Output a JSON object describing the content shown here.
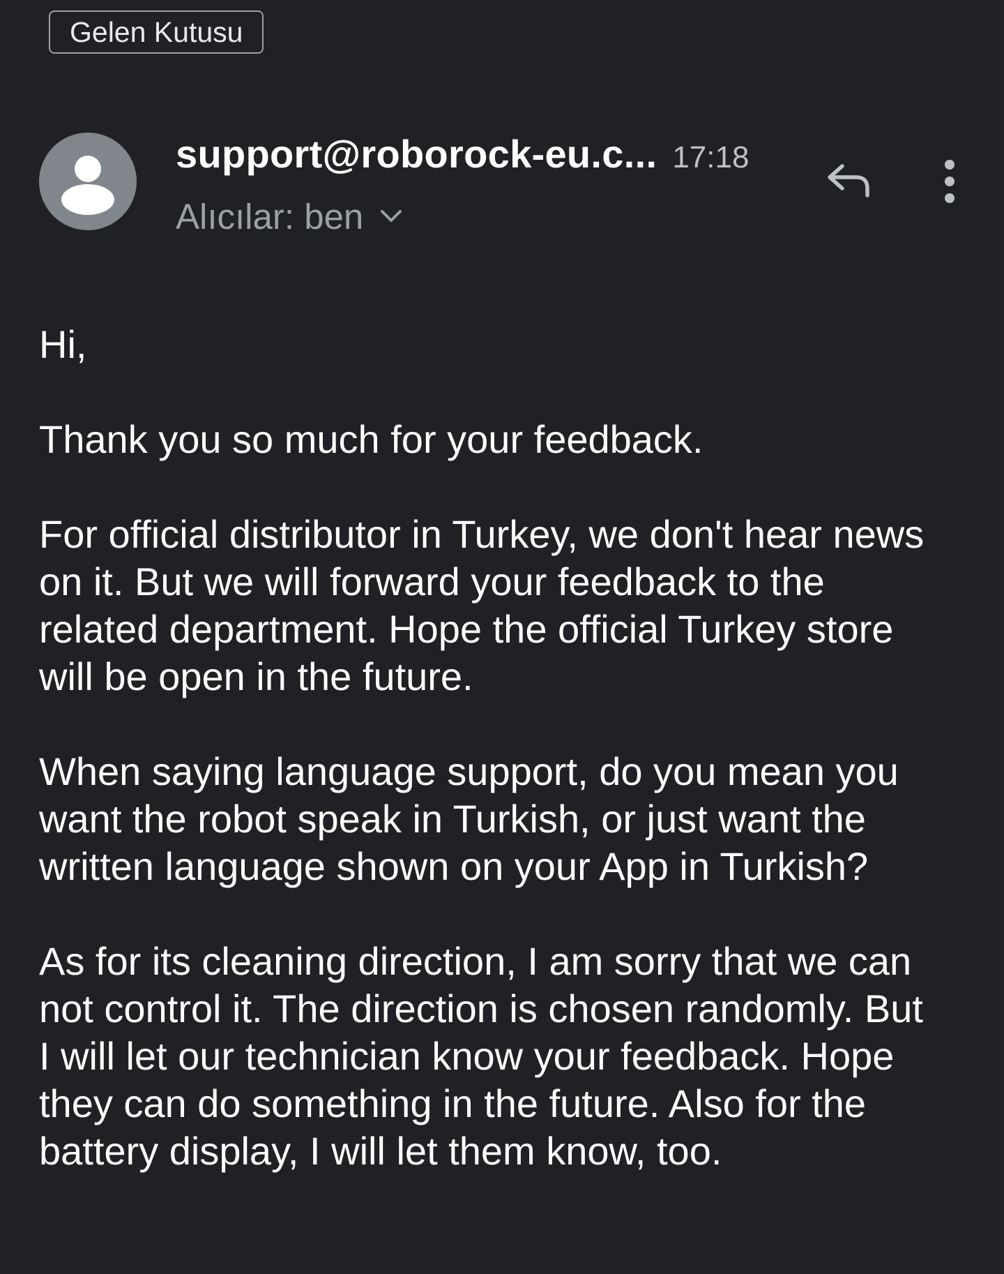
{
  "header": {
    "label_chip": "Gelen Kutusu"
  },
  "message": {
    "sender": "support@roborock-eu.c...",
    "time": "17:18",
    "recipients": "Alıcılar: ben",
    "icons": {
      "avatar": "person-avatar-icon",
      "expand": "chevron-down-icon",
      "reply": "reply-icon",
      "more": "more-vert-icon"
    }
  },
  "body": {
    "paragraphs": [
      "Hi,",
      "Thank you so much for your feedback.",
      "For official distributor in Turkey, we don't hear news\non it. But we will forward your feedback to the\nrelated department. Hope the official Turkey store\nwill be open in the future.",
      "When saying language support, do you mean you\nwant the robot speak in Turkish, or just want the\nwritten language shown on your App in Turkish?",
      "As for its cleaning direction, I am sorry that we can\nnot control it. The direction is chosen randomly. But\nI will let our technician know your feedback. Hope\nthey can do something in the future. Also for the\nbattery display, I will let them know, too."
    ]
  },
  "colors": {
    "background": "#202124",
    "avatar": "#80868b",
    "secondary_text": "#9aa0a6"
  }
}
